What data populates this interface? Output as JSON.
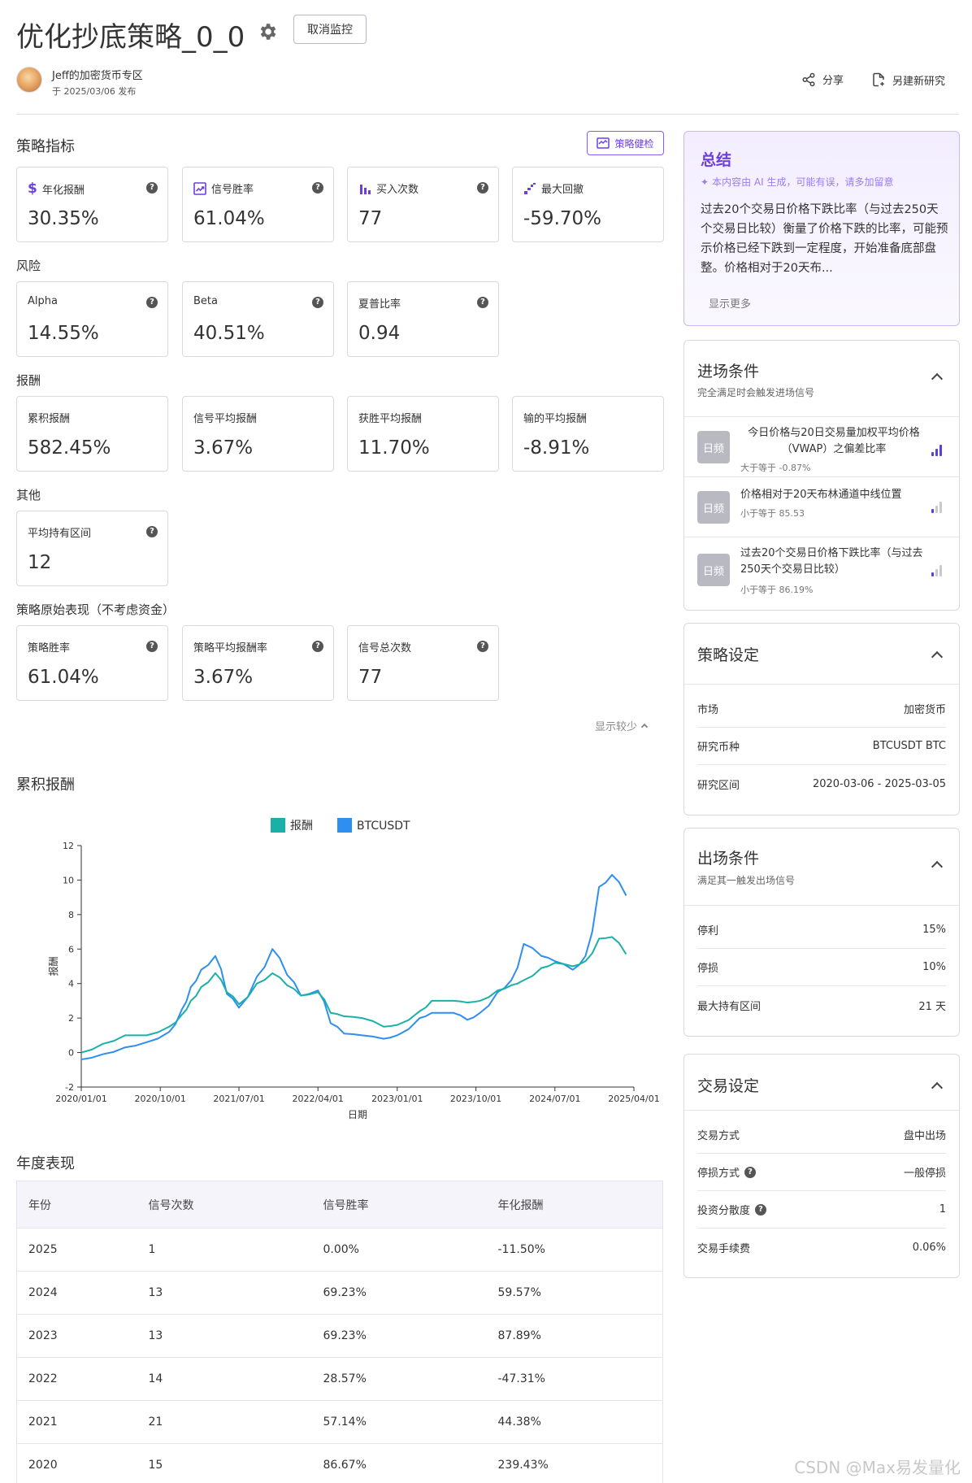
{
  "header": {
    "title": "优化抄底策略_0_0",
    "cancel_button": "取消监控",
    "author": "Jeff的加密货币专区",
    "published": "于 2025/03/06 发布",
    "share": "分享",
    "new_research": "另建新研究"
  },
  "metrics": {
    "title": "策略指标",
    "health_button": "策略健检",
    "main": [
      {
        "label": "年化报酬",
        "value": "30.35%",
        "icon": "dollar-icon"
      },
      {
        "label": "信号胜率",
        "value": "61.04%",
        "icon": "trend-chart-icon"
      },
      {
        "label": "买入次数",
        "value": "77",
        "icon": "bar-chart-icon"
      },
      {
        "label": "最大回撤",
        "value": "-59.70%",
        "icon": "stairs-icon"
      }
    ],
    "risk_title": "风险",
    "risk": [
      {
        "label": "Alpha",
        "value": "14.55%"
      },
      {
        "label": "Beta",
        "value": "40.51%"
      },
      {
        "label": "夏普比率",
        "value": "0.94"
      }
    ],
    "return_title": "报酬",
    "returns": [
      {
        "label": "累积报酬",
        "value": "582.45%"
      },
      {
        "label": "信号平均报酬",
        "value": "3.67%"
      },
      {
        "label": "获胜平均报酬",
        "value": "11.70%"
      },
      {
        "label": "输的平均报酬",
        "value": "-8.91%"
      }
    ],
    "other_title": "其他",
    "other": [
      {
        "label": "平均持有区间",
        "value": "12"
      }
    ],
    "raw_title": "策略原始表现（不考虑资金）",
    "raw": [
      {
        "label": "策略胜率",
        "value": "61.04%"
      },
      {
        "label": "策略平均报酬率",
        "value": "3.67%"
      },
      {
        "label": "信号总次数",
        "value": "77"
      }
    ],
    "show_less": "显示较少"
  },
  "chart_data": {
    "type": "line",
    "title": "累积报酬",
    "xlabel": "日期",
    "ylabel": "报酬",
    "ylim": [
      -2,
      12
    ],
    "yticks": [
      "-2",
      "0",
      "2",
      "4",
      "6",
      "8",
      "10",
      "12"
    ],
    "xticks": [
      "2020/01/01",
      "2020/10/01",
      "2021/07/01",
      "2022/04/01",
      "2023/01/01",
      "2023/10/01",
      "2024/07/01",
      "2025/04/01"
    ],
    "legend_position": "top",
    "series": [
      {
        "name": "报酬",
        "color": "#1ab0a8",
        "x": [
          "2020/01/01",
          "2020/03/15",
          "2020/06/01",
          "2020/08/15",
          "2020/11/01",
          "2020/12/15",
          "2021/01/15",
          "2021/02/20",
          "2021/04/10",
          "2021/05/20",
          "2021/07/01",
          "2021/09/01",
          "2021/10/25",
          "2021/12/15",
          "2022/02/01",
          "2022/04/01",
          "2022/05/15",
          "2022/07/01",
          "2022/09/01",
          "2022/11/15",
          "2023/01/01",
          "2023/03/20",
          "2023/05/01",
          "2023/07/15",
          "2023/09/01",
          "2023/10/15",
          "2023/12/15",
          "2024/02/01",
          "2024/03/15",
          "2024/05/15",
          "2024/07/01",
          "2024/09/01",
          "2024/10/15",
          "2024/12/01",
          "2025/01/15",
          "2025/03/05"
        ],
        "y": [
          0.0,
          0.5,
          1.0,
          1.0,
          1.5,
          2.2,
          3.0,
          3.8,
          4.6,
          3.5,
          2.8,
          4.0,
          4.6,
          3.9,
          3.3,
          3.5,
          2.3,
          2.1,
          2.0,
          1.5,
          1.6,
          2.4,
          3.0,
          3.0,
          2.9,
          3.0,
          3.6,
          3.9,
          4.2,
          4.9,
          5.2,
          5.0,
          5.3,
          6.6,
          6.7,
          5.7
        ]
      },
      {
        "name": "BTCUSDT",
        "color": "#2e8ff0",
        "x": [
          "2020/01/01",
          "2020/03/15",
          "2020/06/01",
          "2020/08/15",
          "2020/11/01",
          "2020/12/15",
          "2021/01/15",
          "2021/02/20",
          "2021/04/10",
          "2021/05/20",
          "2021/07/01",
          "2021/09/01",
          "2021/10/25",
          "2021/12/15",
          "2022/02/01",
          "2022/04/01",
          "2022/05/15",
          "2022/07/01",
          "2022/09/01",
          "2022/11/15",
          "2023/01/01",
          "2023/03/20",
          "2023/05/01",
          "2023/07/15",
          "2023/09/01",
          "2023/10/15",
          "2023/12/15",
          "2024/02/01",
          "2024/03/15",
          "2024/05/15",
          "2024/07/01",
          "2024/09/01",
          "2024/10/15",
          "2024/12/01",
          "2025/01/15",
          "2025/03/05"
        ],
        "y": [
          -0.4,
          -0.1,
          0.3,
          0.6,
          1.2,
          2.5,
          3.8,
          4.8,
          5.6,
          3.4,
          2.6,
          4.4,
          6.0,
          4.5,
          3.3,
          3.6,
          1.7,
          1.1,
          1.0,
          0.8,
          1.0,
          2.0,
          2.3,
          2.3,
          1.9,
          2.3,
          3.5,
          4.2,
          6.3,
          5.6,
          5.3,
          4.8,
          5.6,
          9.6,
          10.3,
          9.1
        ]
      }
    ]
  },
  "annual": {
    "title": "年度表现",
    "columns": [
      "年份",
      "信号次数",
      "信号胜率",
      "年化报酬"
    ],
    "rows": [
      [
        "2025",
        "1",
        "0.00%",
        "-11.50%"
      ],
      [
        "2024",
        "13",
        "69.23%",
        "59.57%"
      ],
      [
        "2023",
        "13",
        "69.23%",
        "87.89%"
      ],
      [
        "2022",
        "14",
        "28.57%",
        "-47.31%"
      ],
      [
        "2021",
        "21",
        "57.14%",
        "44.38%"
      ],
      [
        "2020",
        "15",
        "86.67%",
        "239.43%"
      ]
    ]
  },
  "summary": {
    "title": "总结",
    "ai_note": "本内容由 AI 生成，可能有误，请多加留意",
    "text": "过去20个交易日价格下跌比率（与过去250天个交易日比较）衡量了价格下跌的比率，可能预示价格已经下跌到一定程度，开始准备底部盘整。价格相对于20天布...",
    "show_more": "显示更多"
  },
  "entry": {
    "title": "进场条件",
    "subtitle": "完全满足时会触发进场信号",
    "items": [
      {
        "freq": "日频",
        "text": "今日价格与20日交易量加权平均价格（VWAP）之偏差比率",
        "crit": "大于等于 -0.87%",
        "level": 3
      },
      {
        "freq": "日频",
        "text": "价格相对于20天布林通道中线位置",
        "crit": "小于等于 85.53",
        "level": 1
      },
      {
        "freq": "日频",
        "text": "过去20个交易日价格下跌比率（与过去250天个交易日比较）",
        "crit": "小于等于 86.19%",
        "level": 1
      }
    ]
  },
  "settings": {
    "title": "策略设定",
    "rows": [
      {
        "label": "市场",
        "value": "加密货币"
      },
      {
        "label": "研究币种",
        "value": "BTCUSDT BTC"
      },
      {
        "label": "研究区间",
        "value": "2020-03-06 - 2025-03-05"
      }
    ]
  },
  "exit": {
    "title": "出场条件",
    "subtitle": "满足其一触发出场信号",
    "rows": [
      {
        "label": "停利",
        "value": "15%"
      },
      {
        "label": "停损",
        "value": "10%"
      },
      {
        "label": "最大持有区间",
        "value": "21 天"
      }
    ]
  },
  "trade": {
    "title": "交易设定",
    "rows": [
      {
        "label": "交易方式",
        "value": "盘中出场"
      },
      {
        "label": "停损方式",
        "value": "一般停损"
      },
      {
        "label": "投资分散度",
        "value": "1"
      },
      {
        "label": "交易手续费",
        "value": "0.06%"
      }
    ]
  },
  "watermark": "CSDN @Max易发量化"
}
